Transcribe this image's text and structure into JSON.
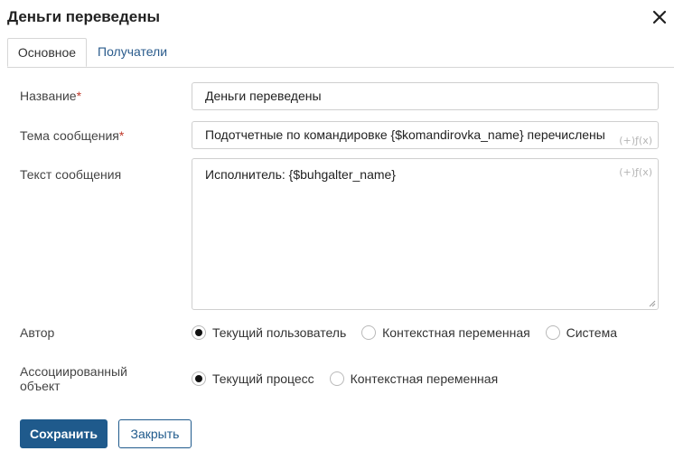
{
  "dialog": {
    "title": "Деньги переведены",
    "close_icon": "close-icon"
  },
  "tabs": [
    {
      "label": "Основное",
      "active": true
    },
    {
      "label": "Получатели",
      "active": false
    }
  ],
  "form": {
    "name": {
      "label": "Название",
      "required_mark": "*",
      "value": "Деньги переведены"
    },
    "subject": {
      "label": "Тема сообщения",
      "required_mark": "*",
      "value": "Подотчетные по командировке {$komandirovka_name} перечислены",
      "fx": "(+)ƒ(x)"
    },
    "message": {
      "label": "Текст сообщения",
      "value": "Исполнитель: {$buhgalter_name}",
      "fx": "(+)ƒ(x)"
    },
    "author": {
      "label": "Автор",
      "options": [
        {
          "label": "Текущий пользователь",
          "selected": true
        },
        {
          "label": "Контекстная переменная",
          "selected": false
        },
        {
          "label": "Система",
          "selected": false
        }
      ]
    },
    "associated": {
      "label_line1": "Ассоциированный",
      "label_line2": "объект",
      "options": [
        {
          "label": "Текущий процесс",
          "selected": true
        },
        {
          "label": "Контекстная переменная",
          "selected": false
        }
      ]
    }
  },
  "buttons": {
    "save": "Сохранить",
    "close": "Закрыть"
  },
  "colors": {
    "primary": "#1f5a8c",
    "tab_link": "#2a5b8c",
    "required": "#c0392b"
  }
}
